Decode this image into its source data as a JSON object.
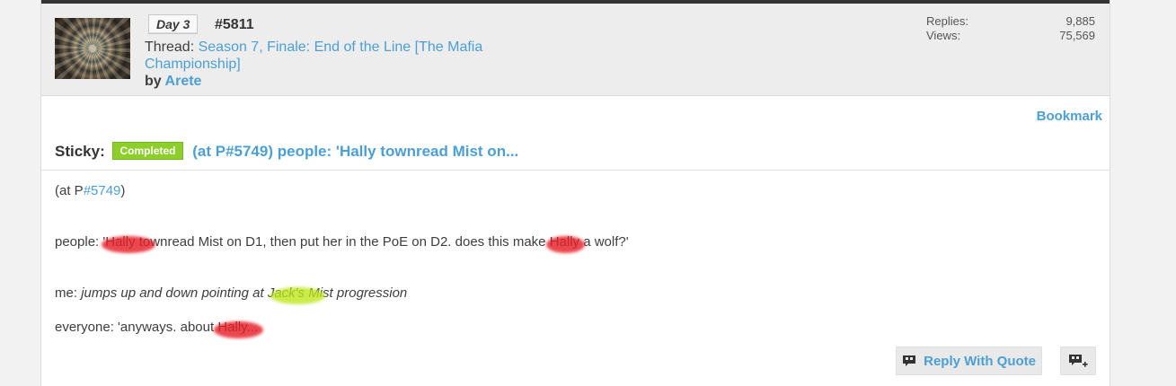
{
  "thread_header": {
    "day_badge": "Day 3",
    "post_number": "#5811",
    "thread_prefix": "Thread:",
    "thread_title": "Season 7, Finale: End of the Line [The Mafia Championship]",
    "by_prefix": "by",
    "author": "Arete",
    "stats": {
      "replies_label": "Replies:",
      "replies_value": "9,885",
      "views_label": "Views:",
      "views_value": "75,569"
    }
  },
  "post": {
    "bookmark_label": "Bookmark",
    "sticky_label": "Sticky:",
    "status_badge": "Completed",
    "title": "(at P#5749) people: 'Hally townread Mist on...",
    "lines": {
      "l1_prefix": "(at P",
      "l1_link": "#5749",
      "l1_suffix": ")",
      "l2_a": "people: '",
      "l2_r1": "Hally to",
      "l2_b": "wnread Mist on D1, then put her in the PoE on D2. does this make ",
      "l2_r2": "Hally",
      "l2_c": " a wolf?'",
      "l3_a": "me: ",
      "l3_i1": "jumps up and down pointing at J",
      "l3_g": "ack's M",
      "l3_i2": "ist progression",
      "l4_a": "everyone: 'anyways. about ",
      "l4_r": "Hally..."
    }
  },
  "actions": {
    "reply_quote_label": "Reply With Quote",
    "multiquote_icon": "multiquote-icon"
  },
  "colors": {
    "link": "#4b9fd5",
    "completed_badge": "#8dcf2a",
    "redaction_red": "#e61e28",
    "highlight_green": "#bee61e"
  }
}
